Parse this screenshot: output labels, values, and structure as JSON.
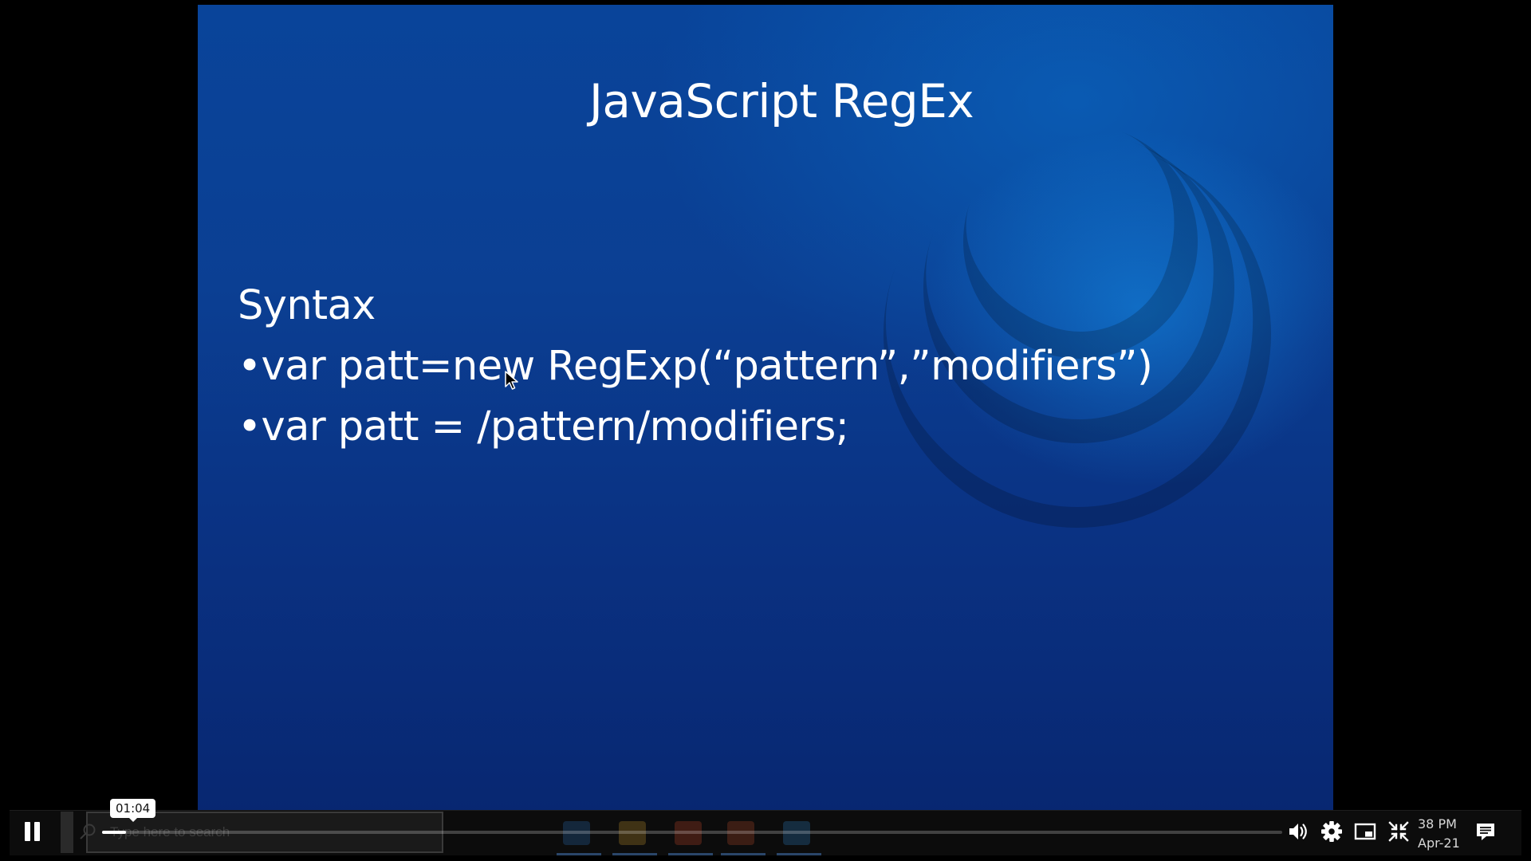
{
  "slide": {
    "title": "JavaScript RegEx",
    "lines": [
      "Syntax",
      "•var patt=new RegExp(“pattern”,”modifiers”)",
      "•var patt = /pattern/modifiers;"
    ]
  },
  "player": {
    "time_tooltip": "01:04",
    "progress_fraction": 0.02
  },
  "taskbar_ghost": {
    "search_placeholder": "Type here to search",
    "clock_time": "38 PM",
    "clock_date": "Apr-21"
  },
  "icons": [
    "pause-icon",
    "search-icon",
    "volume-icon",
    "gear-icon",
    "picture-in-picture-icon",
    "exit-fullscreen-icon",
    "notifications-icon"
  ],
  "colors": {
    "slide_bg_top": "#09449a",
    "slide_bg_bottom": "#082771",
    "seek_fill": "#ffffff",
    "controls_bg": "#0c0c0c"
  }
}
